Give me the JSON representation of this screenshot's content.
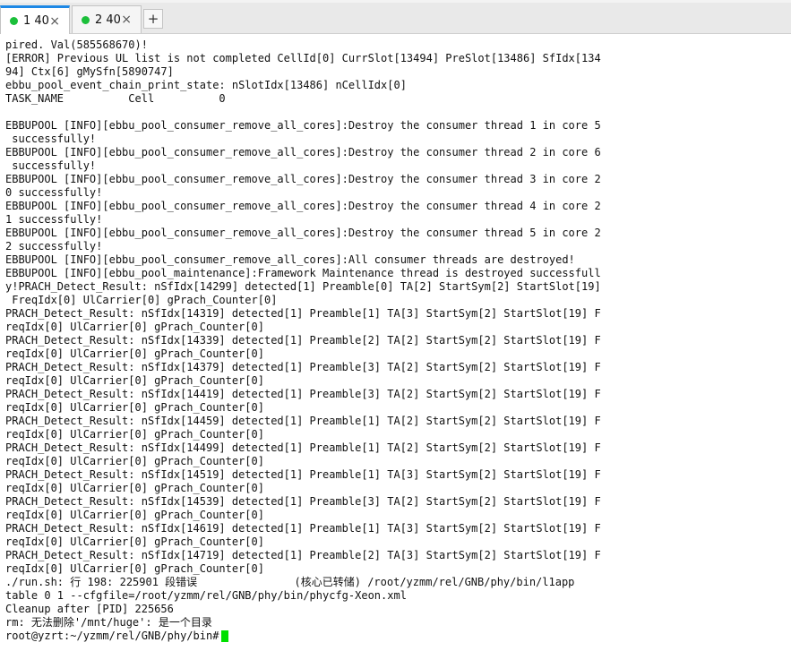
{
  "tabs": [
    {
      "label": "1 40",
      "active": true,
      "status": "connected"
    },
    {
      "label": "2 40",
      "active": false,
      "status": "connected"
    }
  ],
  "tab_close_glyph": "×",
  "tab_add_glyph": "+",
  "colors": {
    "active_tab_accent": "#1e88e5",
    "status_dot": "#1bbf3a",
    "cursor": "#00e000",
    "terminal_bg": "#ffffff",
    "terminal_fg": "#111111"
  },
  "terminal": {
    "lines": [
      "pired. Val(585568670)!",
      "[ERROR] Previous UL list is not completed CellId[0] CurrSlot[13494] PreSlot[13486] SfIdx[134",
      "94] Ctx[6] gMySfn[5890747]",
      "ebbu_pool_event_chain_print_state: nSlotIdx[13486] nCellIdx[0]",
      "TASK_NAME          Cell          0",
      "",
      "EBBUPOOL [INFO][ebbu_pool_consumer_remove_all_cores]:Destroy the consumer thread 1 in core 5",
      " successfully!",
      "EBBUPOOL [INFO][ebbu_pool_consumer_remove_all_cores]:Destroy the consumer thread 2 in core 6",
      " successfully!",
      "EBBUPOOL [INFO][ebbu_pool_consumer_remove_all_cores]:Destroy the consumer thread 3 in core 2",
      "0 successfully!",
      "EBBUPOOL [INFO][ebbu_pool_consumer_remove_all_cores]:Destroy the consumer thread 4 in core 2",
      "1 successfully!",
      "EBBUPOOL [INFO][ebbu_pool_consumer_remove_all_cores]:Destroy the consumer thread 5 in core 2",
      "2 successfully!",
      "EBBUPOOL [INFO][ebbu_pool_consumer_remove_all_cores]:All consumer threads are destroyed!",
      "EBBUPOOL [INFO][ebbu_pool_maintenance]:Framework Maintenance thread is destroyed successfull",
      "y!PRACH_Detect_Result: nSfIdx[14299] detected[1] Preamble[0] TA[2] StartSym[2] StartSlot[19]",
      " FreqIdx[0] UlCarrier[0] gPrach_Counter[0]",
      "PRACH_Detect_Result: nSfIdx[14319] detected[1] Preamble[1] TA[3] StartSym[2] StartSlot[19] F",
      "reqIdx[0] UlCarrier[0] gPrach_Counter[0]",
      "PRACH_Detect_Result: nSfIdx[14339] detected[1] Preamble[2] TA[2] StartSym[2] StartSlot[19] F",
      "reqIdx[0] UlCarrier[0] gPrach_Counter[0]",
      "PRACH_Detect_Result: nSfIdx[14379] detected[1] Preamble[3] TA[2] StartSym[2] StartSlot[19] F",
      "reqIdx[0] UlCarrier[0] gPrach_Counter[0]",
      "PRACH_Detect_Result: nSfIdx[14419] detected[1] Preamble[3] TA[2] StartSym[2] StartSlot[19] F",
      "reqIdx[0] UlCarrier[0] gPrach_Counter[0]",
      "PRACH_Detect_Result: nSfIdx[14459] detected[1] Preamble[1] TA[2] StartSym[2] StartSlot[19] F",
      "reqIdx[0] UlCarrier[0] gPrach_Counter[0]",
      "PRACH_Detect_Result: nSfIdx[14499] detected[1] Preamble[1] TA[2] StartSym[2] StartSlot[19] F",
      "reqIdx[0] UlCarrier[0] gPrach_Counter[0]",
      "PRACH_Detect_Result: nSfIdx[14519] detected[1] Preamble[1] TA[3] StartSym[2] StartSlot[19] F",
      "reqIdx[0] UlCarrier[0] gPrach_Counter[0]",
      "PRACH_Detect_Result: nSfIdx[14539] detected[1] Preamble[3] TA[2] StartSym[2] StartSlot[19] F",
      "reqIdx[0] UlCarrier[0] gPrach_Counter[0]",
      "PRACH_Detect_Result: nSfIdx[14619] detected[1] Preamble[1] TA[3] StartSym[2] StartSlot[19] F",
      "reqIdx[0] UlCarrier[0] gPrach_Counter[0]",
      "PRACH_Detect_Result: nSfIdx[14719] detected[1] Preamble[2] TA[3] StartSym[2] StartSlot[19] F",
      "reqIdx[0] UlCarrier[0] gPrach_Counter[0]",
      "./run.sh: 行 198: 225901 段错误               (核心已转储) /root/yzmm/rel/GNB/phy/bin/l1app",
      "table 0 1 --cfgfile=/root/yzmm/rel/GNB/phy/bin/phycfg-Xeon.xml",
      "Cleanup after [PID] 225656",
      "rm: 无法删除'/mnt/huge': 是一个目录"
    ],
    "prompt": "root@yzrt:~/yzmm/rel/GNB/phy/bin#"
  }
}
